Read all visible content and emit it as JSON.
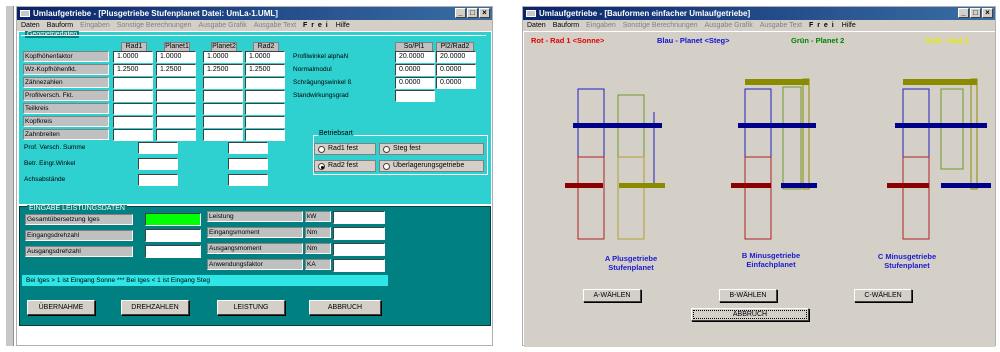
{
  "left_window": {
    "title": "Umlaufgetriebe - [Plusgetriebe Stufenplanet  Datei: UmLa-1.UML]",
    "menu": [
      {
        "label": "Daten",
        "disabled": false
      },
      {
        "label": "Bauform",
        "disabled": false
      },
      {
        "label": "Eingaben",
        "disabled": true
      },
      {
        "label": "Sonstige Berechnungen",
        "disabled": true
      },
      {
        "label": "Ausgabe Grafik",
        "disabled": true
      },
      {
        "label": "Ausgabe Text",
        "disabled": true
      },
      {
        "label": "F r e i",
        "disabled": false,
        "bold": true
      },
      {
        "label": "Hilfe",
        "disabled": false
      }
    ],
    "geo": {
      "section_title": "Geometriedaten",
      "col_headers": [
        "Rad1",
        "Planet1",
        "Planet2",
        "Rad2"
      ],
      "rows": [
        {
          "label": "Kopfhöhenfaktor",
          "values": [
            "1.0000",
            "1.0000",
            "1.0000",
            "1.0000"
          ]
        },
        {
          "label": "Wz-Kopfhöhenfkt.",
          "values": [
            "1.2500",
            "1.2500",
            "1.2500",
            "1.2500"
          ]
        },
        {
          "label": "Zähnezahlen",
          "values": [
            "",
            "",
            "",
            ""
          ]
        },
        {
          "label": "Profilversch. Fkt.",
          "values": [
            "",
            "",
            "",
            ""
          ]
        },
        {
          "label": "Teilkreis",
          "values": [
            "",
            "",
            "",
            ""
          ]
        },
        {
          "label": "Kopfkreis",
          "values": [
            "",
            "",
            "",
            ""
          ]
        },
        {
          "label": "Zahnbreiten",
          "values": [
            "",
            "",
            "",
            ""
          ]
        }
      ],
      "extra_rows": [
        {
          "label": "Prof. Versch. Summe"
        },
        {
          "label": "Betr. Eingr.Winkel"
        },
        {
          "label": "Achsabstände"
        }
      ],
      "right_headers": [
        "So/Pl1",
        "Pl2/Rad2"
      ],
      "right_rows": [
        {
          "label": "Profilwinkel alphaN",
          "values": [
            "20.0000",
            "20.0000"
          ]
        },
        {
          "label": "Normalmodul",
          "values": [
            "0.0000",
            "0.0000"
          ]
        },
        {
          "label": "Schrägungswinkel ß",
          "values": [
            "0.0000",
            "0.0000"
          ]
        },
        {
          "label": "Standwirkungsgrad",
          "values": [
            ""
          ]
        }
      ]
    },
    "betriebsart": {
      "title": "Betriebsart",
      "options": [
        "Rad1 fest",
        "Steg fest",
        "Rad2 fest",
        "Überlagerungsgetriebe"
      ],
      "selected": "Rad2 fest"
    },
    "leistung": {
      "section_title": "EINGABE LEISTUNGSDATEN",
      "left_rows": [
        "Gesamtübersetzung  Iges",
        "Eingangsdrehzahl",
        "Ausgangsdrehzahl"
      ],
      "right_rows": [
        {
          "label": "Leistung",
          "unit": "kW"
        },
        {
          "label": "Eingangsmoment",
          "unit": "Nm"
        },
        {
          "label": "Ausgangsmoment",
          "unit": "Nm"
        },
        {
          "label": "Anwendungsfaktor",
          "unit": "KA"
        }
      ],
      "hint": "Bei Iges > 1 ist Eingang Sonne  ***  Bei Iges < 1 ist Eingang Steg",
      "highlight_color": "#00ff00"
    },
    "buttons": [
      "ÜBERNAHME",
      "DREHZAHLEN",
      "LEISTUNG",
      "ABBRUCH"
    ]
  },
  "right_window": {
    "title": "Umlaufgetriebe - [Bauformen einfacher Umlaufgetriebe]",
    "menu": [
      {
        "label": "Daten",
        "disabled": false
      },
      {
        "label": "Bauform",
        "disabled": false
      },
      {
        "label": "Eingaben",
        "disabled": true
      },
      {
        "label": "Sonstige Berechnungen",
        "disabled": true
      },
      {
        "label": "Ausgabe Grafik",
        "disabled": true
      },
      {
        "label": "Ausgabe Text",
        "disabled": true
      },
      {
        "label": "F r e i",
        "disabled": false,
        "bold": true
      },
      {
        "label": "Hilfe",
        "disabled": false
      }
    ],
    "legend": [
      {
        "text": "Rot - Rad 1 <Sonne>",
        "color": "#e00000"
      },
      {
        "text": "Blau - Planet <Steg>",
        "color": "#1010d0"
      },
      {
        "text": "Grün - Planet 2",
        "color": "#008000"
      },
      {
        "text": "Gelb - Rad 2",
        "color": "#e8e800"
      }
    ],
    "captions": [
      {
        "line1": "A Plusgetriebe",
        "line2": "Stufenplanet"
      },
      {
        "line1": "B Minusgetriebe",
        "line2": "Einfachplanet"
      },
      {
        "line1": "C Minusgetriebe",
        "line2": "Stufenplanet"
      }
    ],
    "buttons": [
      "A-WÄHLEN",
      "B-WÄHLEN",
      "C-WÄHLEN"
    ],
    "cancel": "ABBRUCH",
    "colors": {
      "red": "#8b0000",
      "blue": "#00008b",
      "olive": "#8b8b00",
      "outline_red": "#b02020",
      "outline_green": "#6a9a2a",
      "outline_blue": "#2020c0"
    }
  }
}
